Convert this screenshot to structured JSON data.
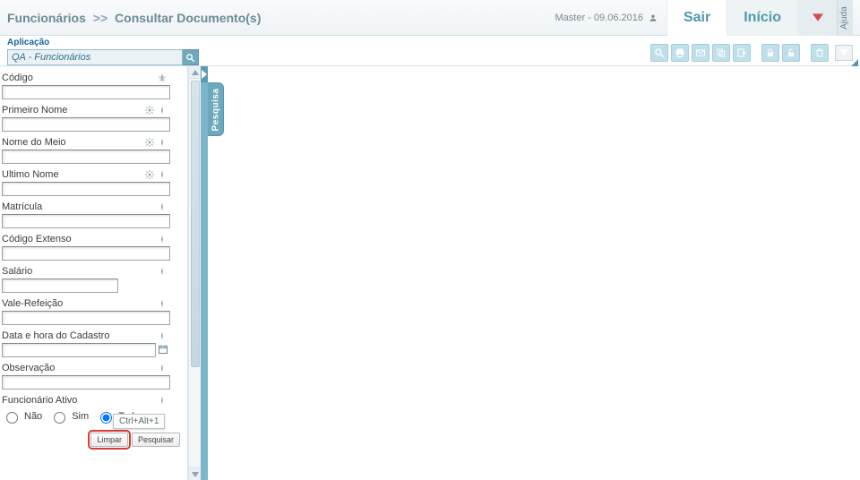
{
  "header": {
    "crumb1": "Funcionários",
    "sep": ">>",
    "crumb2": "Consultar Documento(s)",
    "user_text": "Master - 09.06.2016",
    "btn_sair": "Sair",
    "btn_inicio": "Início",
    "help_label": "Ajuda"
  },
  "appbar": {
    "label": "Aplicação",
    "combo_value": "QA - Funcionários"
  },
  "side_tab_label": "Pesquisa",
  "tooltip": "Ctrl+Alt+1",
  "fields": {
    "codigo": {
      "label": "Código",
      "value": ""
    },
    "primeiro_nome": {
      "label": "Primeiro Nome",
      "value": ""
    },
    "nome_meio": {
      "label": "Nome do Meio",
      "value": ""
    },
    "ultimo_nome": {
      "label": "Ultimo Nome",
      "value": ""
    },
    "matricula": {
      "label": "Matrícula",
      "value": ""
    },
    "codigo_extenso": {
      "label": "Código Extenso",
      "value": ""
    },
    "salario": {
      "label": "Salário",
      "value": ""
    },
    "vale_refeicao": {
      "label": "Vale-Refeição",
      "value": ""
    },
    "data_cadastro": {
      "label": "Data e hora do Cadastro",
      "value": ""
    },
    "observacao": {
      "label": "Observação",
      "value": ""
    },
    "ativo": {
      "label": "Funcionário Ativo",
      "opt_nao": "Não",
      "opt_sim": "Sim",
      "opt_todos": "Todos",
      "selected": "todos"
    }
  },
  "buttons": {
    "limpar": "Limpar",
    "pesquisar": "Pesquisar"
  }
}
